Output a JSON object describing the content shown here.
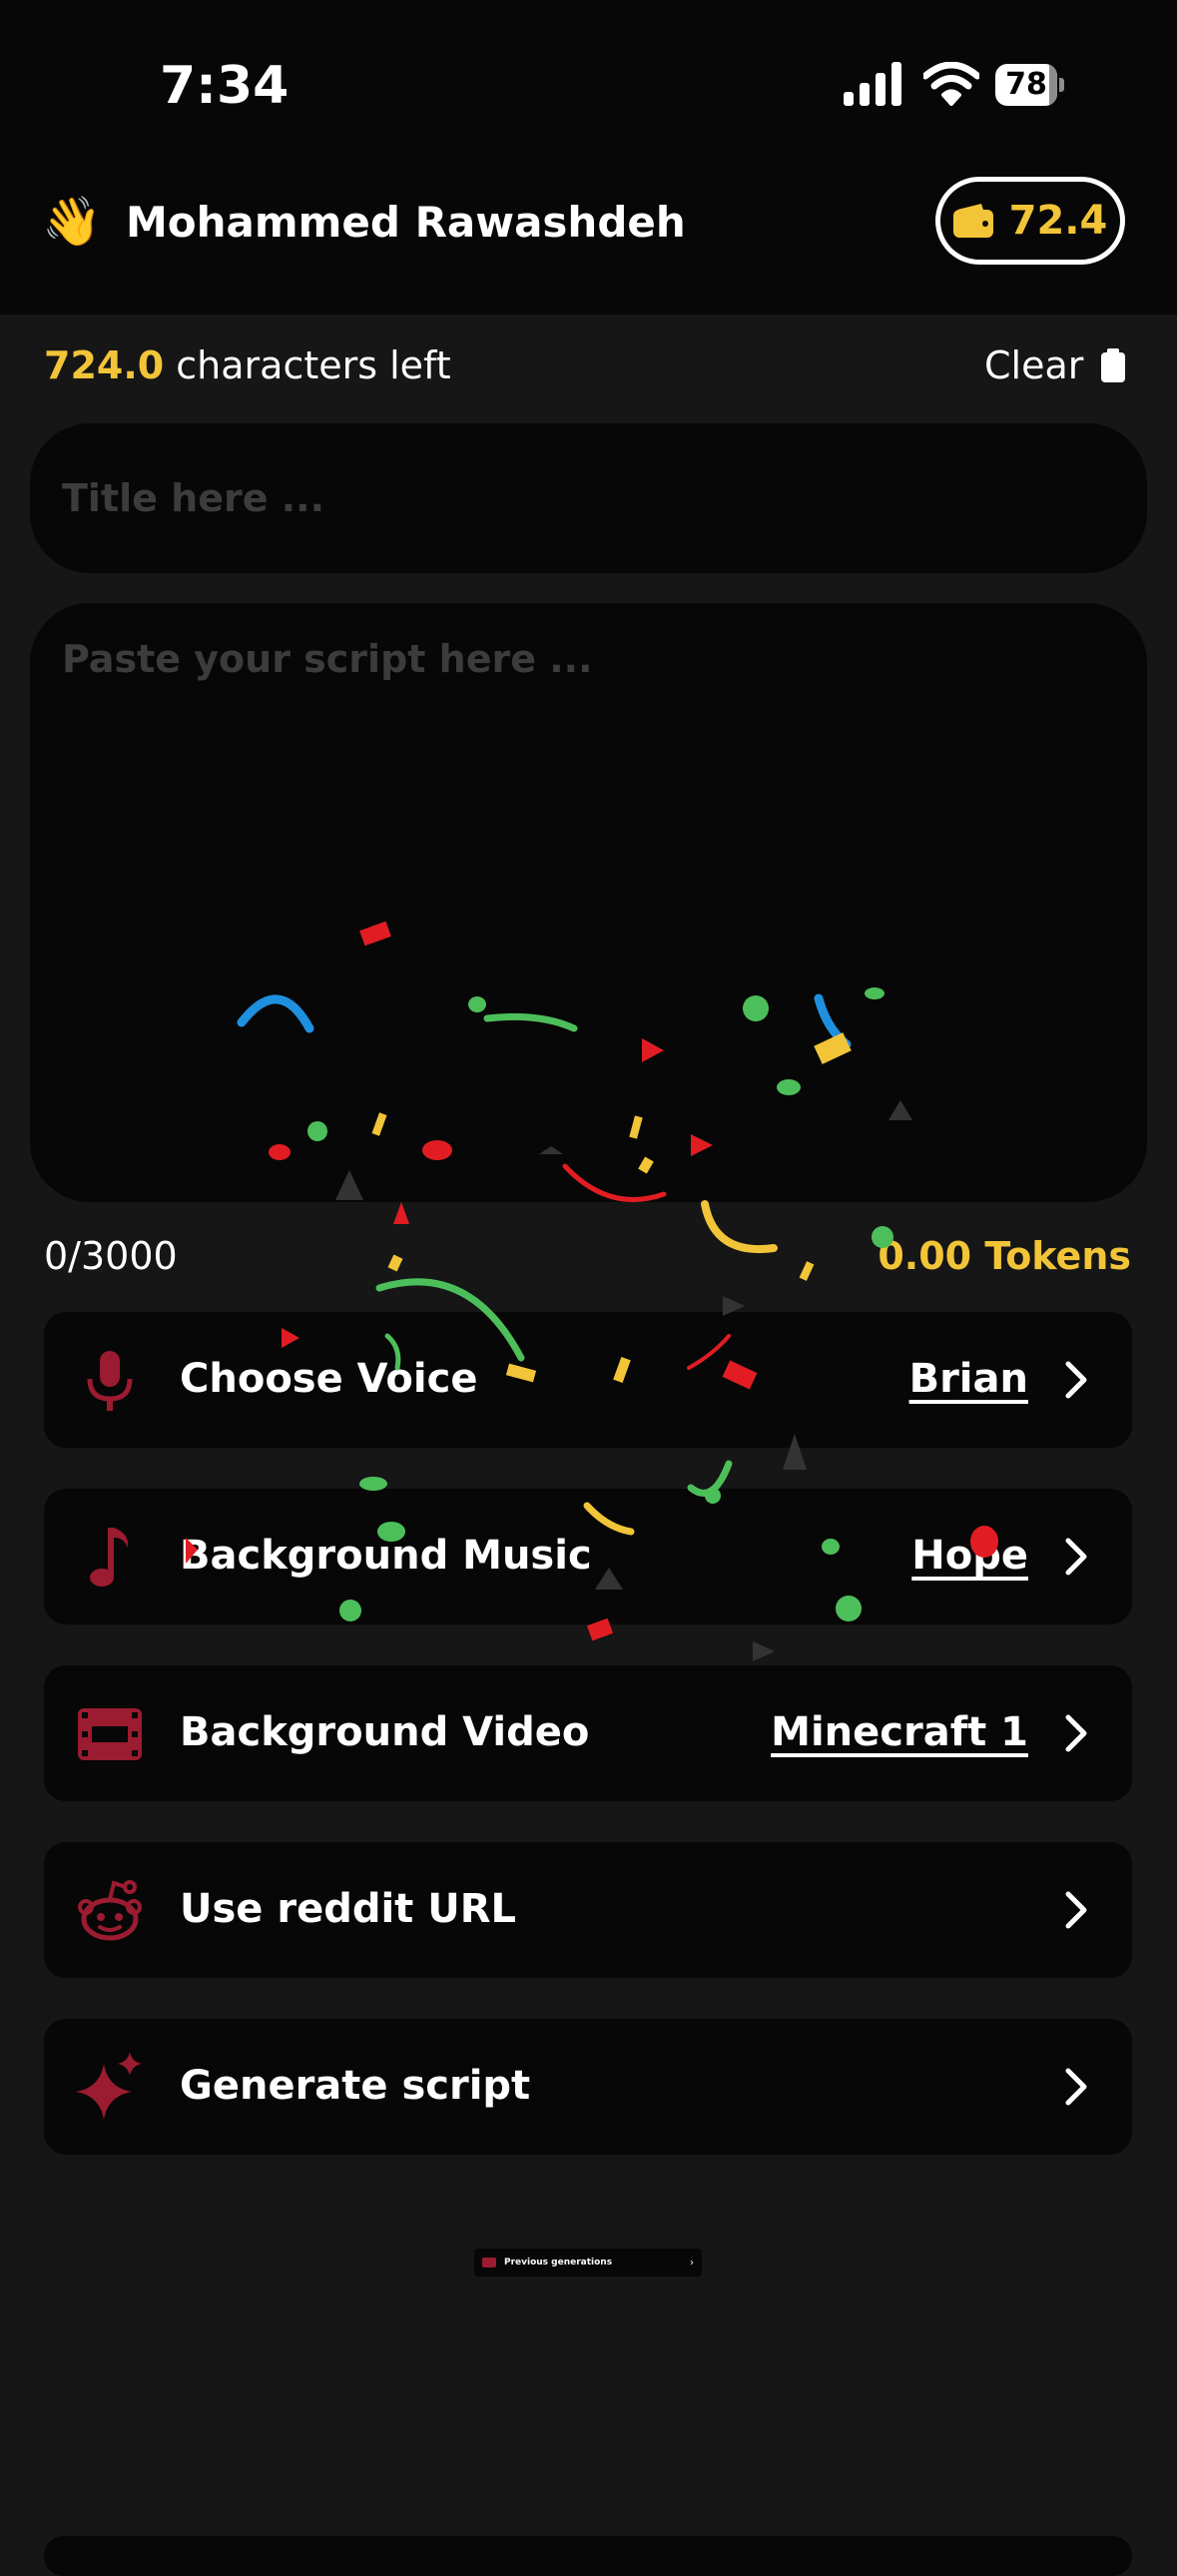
{
  "status_bar": {
    "time": "7:34",
    "battery": "78",
    "battery_level": 0.78
  },
  "header": {
    "greeting_emoji": "👋",
    "user_name": "Mohammed Rawashdeh",
    "wallet_balance": "72.4"
  },
  "editor": {
    "characters_left_value": "724.0",
    "characters_left_label": " characters left",
    "clear_label": "Clear",
    "title_placeholder": "Title here ...",
    "script_placeholder": "Paste your script here ...",
    "char_counter": "0/3000",
    "tokens": "0.00 Tokens"
  },
  "options": [
    {
      "label": "Choose Voice",
      "value": "Brian",
      "icon": "microphone-icon"
    },
    {
      "label": "Background Music",
      "value": "Hope",
      "icon": "music-note-icon"
    },
    {
      "label": "Background Video",
      "value": "Minecraft 1",
      "icon": "film-icon"
    },
    {
      "label": "Use reddit URL",
      "value": "",
      "icon": "reddit-icon"
    },
    {
      "label": "Generate script",
      "value": "",
      "icon": "sparkle-icon"
    }
  ],
  "previous_generations": {
    "label": "Previous generations"
  },
  "colors": {
    "accent_yellow": "#f2c438",
    "icon_red": "#9b1b30",
    "background": "#161616",
    "card": "#070707"
  }
}
